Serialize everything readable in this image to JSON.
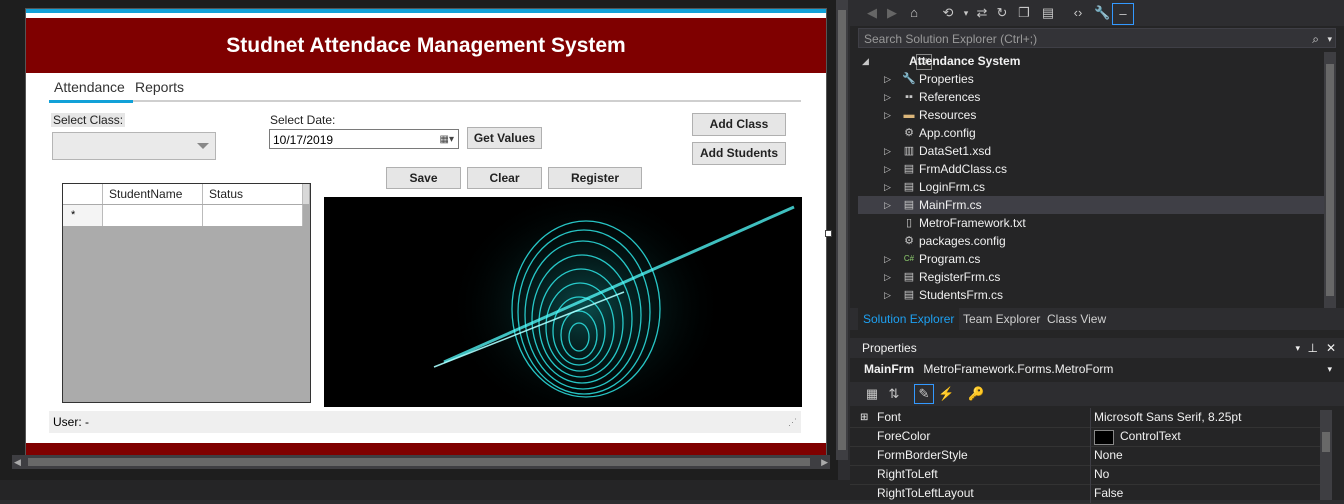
{
  "designer": {
    "form": {
      "title": "Studnet Attendace Management System",
      "tabs": [
        "Attendance",
        "Reports"
      ],
      "select_class_label": "Select Class:",
      "select_date_label": "Select Date:",
      "date_value": "10/17/2019",
      "buttons": {
        "get_values": "Get Values",
        "add_class": "Add Class",
        "add_students": "Add Students",
        "save": "Save",
        "clear": "Clear",
        "register": "Register"
      },
      "grid": {
        "columns": [
          "StudentName",
          "Status"
        ],
        "new_row_marker": "*"
      },
      "status_text": "User:  -"
    }
  },
  "solution_explorer": {
    "search_placeholder": "Search Solution Explorer (Ctrl+;)",
    "project": "Attendance System",
    "items": [
      {
        "label": "Properties",
        "icon": "wrench-icon",
        "expandable": true
      },
      {
        "label": "References",
        "icon": "references-icon",
        "expandable": true
      },
      {
        "label": "Resources",
        "icon": "folder-icon",
        "expandable": true
      },
      {
        "label": "App.config",
        "icon": "config-icon",
        "expandable": false
      },
      {
        "label": "DataSet1.xsd",
        "icon": "dataset-icon",
        "expandable": true
      },
      {
        "label": "FrmAddClass.cs",
        "icon": "form-icon",
        "expandable": true
      },
      {
        "label": "LoginFrm.cs",
        "icon": "form-icon",
        "expandable": true
      },
      {
        "label": "MainFrm.cs",
        "icon": "form-icon",
        "expandable": true,
        "selected": true
      },
      {
        "label": "MetroFramework.txt",
        "icon": "file-icon",
        "expandable": false
      },
      {
        "label": "packages.config",
        "icon": "config-icon",
        "expandable": false
      },
      {
        "label": "Program.cs",
        "icon": "csharp-icon",
        "expandable": true
      },
      {
        "label": "RegisterFrm.cs",
        "icon": "form-icon",
        "expandable": true
      },
      {
        "label": "StudentsFrm.cs",
        "icon": "form-icon",
        "expandable": true
      }
    ],
    "tabs": [
      "Solution Explorer",
      "Team Explorer",
      "Class View"
    ]
  },
  "properties": {
    "title": "Properties",
    "object_name": "MainFrm",
    "object_type": "MetroFramework.Forms.MetroForm",
    "rows": [
      {
        "name": "Font",
        "value": "Microsoft Sans Serif, 8.25pt",
        "expandable": true
      },
      {
        "name": "ForeColor",
        "value": "ControlText",
        "swatch": "#000000"
      },
      {
        "name": "FormBorderStyle",
        "value": "None"
      },
      {
        "name": "RightToLeft",
        "value": "No"
      },
      {
        "name": "RightToLeftLayout",
        "value": "False"
      }
    ]
  },
  "colors": {
    "header_red": "#7f0000",
    "accent_blue": "#11a1d8",
    "vs_dark": "#252526"
  }
}
